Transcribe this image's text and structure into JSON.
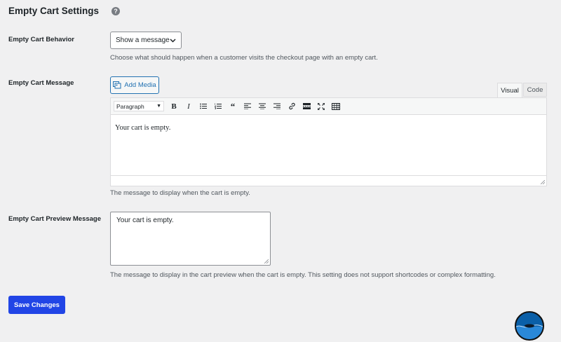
{
  "section_title": "Empty Cart Settings",
  "help_icon": "?",
  "behavior": {
    "label": "Empty Cart Behavior",
    "selected": "Show a message",
    "description": "Choose what should happen when a customer visits the checkout page with an empty cart."
  },
  "message": {
    "label": "Empty Cart Message",
    "add_media": "Add Media",
    "tabs": [
      "Visual",
      "Code"
    ],
    "format_select": "Paragraph",
    "toolbar_icons": [
      "bold-icon",
      "italic-icon",
      "bulleted-list-icon",
      "numbered-list-icon",
      "blockquote-icon",
      "align-left-icon",
      "align-center-icon",
      "align-right-icon",
      "link-icon",
      "read-more-icon",
      "fullscreen-icon",
      "toolbar-toggle-icon"
    ],
    "content": "Your cart is empty.",
    "description": "The message to display when the cart is empty."
  },
  "preview": {
    "label": "Empty Cart Preview Message",
    "value": "Your cart is empty.",
    "description": "The message to display in the cart preview when the cart is empty. This setting does not support shortcodes or complex formatting."
  },
  "save_label": "Save Changes",
  "colors": {
    "accent": "#2271b1",
    "save": "#2145e6"
  }
}
